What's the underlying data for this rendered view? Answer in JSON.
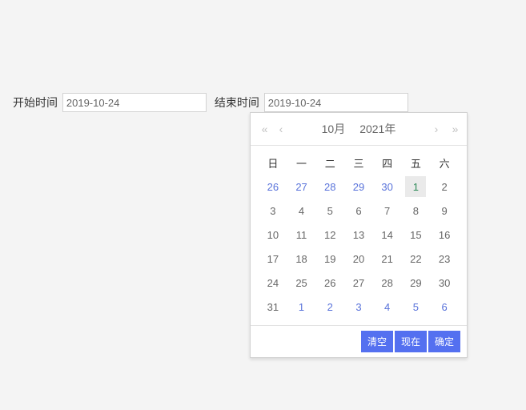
{
  "form": {
    "start_label": "开始时间",
    "end_label": "结束时间",
    "start_value": "2019-10-24",
    "end_value": "2019-10-24"
  },
  "datepicker": {
    "header": {
      "month": "10月",
      "year": "2021年"
    },
    "weekdays": [
      "日",
      "一",
      "二",
      "三",
      "四",
      "五",
      "六"
    ],
    "weeks": [
      [
        {
          "d": "26",
          "other": true
        },
        {
          "d": "27",
          "other": true
        },
        {
          "d": "28",
          "other": true
        },
        {
          "d": "29",
          "other": true
        },
        {
          "d": "30",
          "other": true
        },
        {
          "d": "1",
          "today": true
        },
        {
          "d": "2"
        }
      ],
      [
        {
          "d": "3"
        },
        {
          "d": "4"
        },
        {
          "d": "5"
        },
        {
          "d": "6"
        },
        {
          "d": "7"
        },
        {
          "d": "8"
        },
        {
          "d": "9"
        }
      ],
      [
        {
          "d": "10"
        },
        {
          "d": "11"
        },
        {
          "d": "12"
        },
        {
          "d": "13"
        },
        {
          "d": "14"
        },
        {
          "d": "15"
        },
        {
          "d": "16"
        }
      ],
      [
        {
          "d": "17"
        },
        {
          "d": "18"
        },
        {
          "d": "19"
        },
        {
          "d": "20"
        },
        {
          "d": "21"
        },
        {
          "d": "22"
        },
        {
          "d": "23"
        }
      ],
      [
        {
          "d": "24"
        },
        {
          "d": "25"
        },
        {
          "d": "26"
        },
        {
          "d": "27"
        },
        {
          "d": "28"
        },
        {
          "d": "29"
        },
        {
          "d": "30"
        }
      ],
      [
        {
          "d": "31"
        },
        {
          "d": "1",
          "other": true
        },
        {
          "d": "2",
          "other": true
        },
        {
          "d": "3",
          "other": true
        },
        {
          "d": "4",
          "other": true
        },
        {
          "d": "5",
          "other": true
        },
        {
          "d": "6",
          "other": true
        }
      ]
    ],
    "footer": {
      "clear": "清空",
      "now": "现在",
      "confirm": "确定"
    }
  }
}
